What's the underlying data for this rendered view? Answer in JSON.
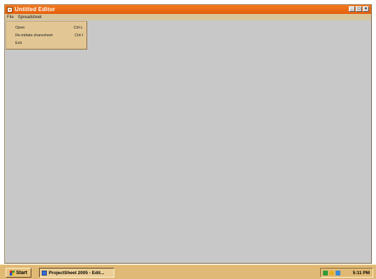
{
  "window": {
    "title": "Untitled Editor",
    "controls": {
      "minimize": "_",
      "maximize": "□",
      "close": "×"
    }
  },
  "menubar": {
    "items": [
      {
        "label": "File"
      },
      {
        "label": "Spreadsheet"
      }
    ]
  },
  "file_menu": {
    "items": [
      {
        "label": "Open",
        "shortcut": "Ctrl-L"
      },
      {
        "label": "Re-initiate sharesheet",
        "shortcut": "Ctrl-I"
      },
      {
        "label": "Exit",
        "shortcut": ""
      }
    ]
  },
  "taskbar": {
    "start_label": "Start",
    "task_label": "ProjectSheet 2005 - Edit...",
    "tray_icons": [
      "network-icon",
      "sound-icon",
      "monitor-icon"
    ],
    "clock": "5:11 PM"
  },
  "colors": {
    "title_bar": "#e8620f",
    "menu_bar": "#d9c59a",
    "dropdown": "#e2c795",
    "client_area": "#c8c8c8",
    "taskbar": "#e0b974"
  }
}
